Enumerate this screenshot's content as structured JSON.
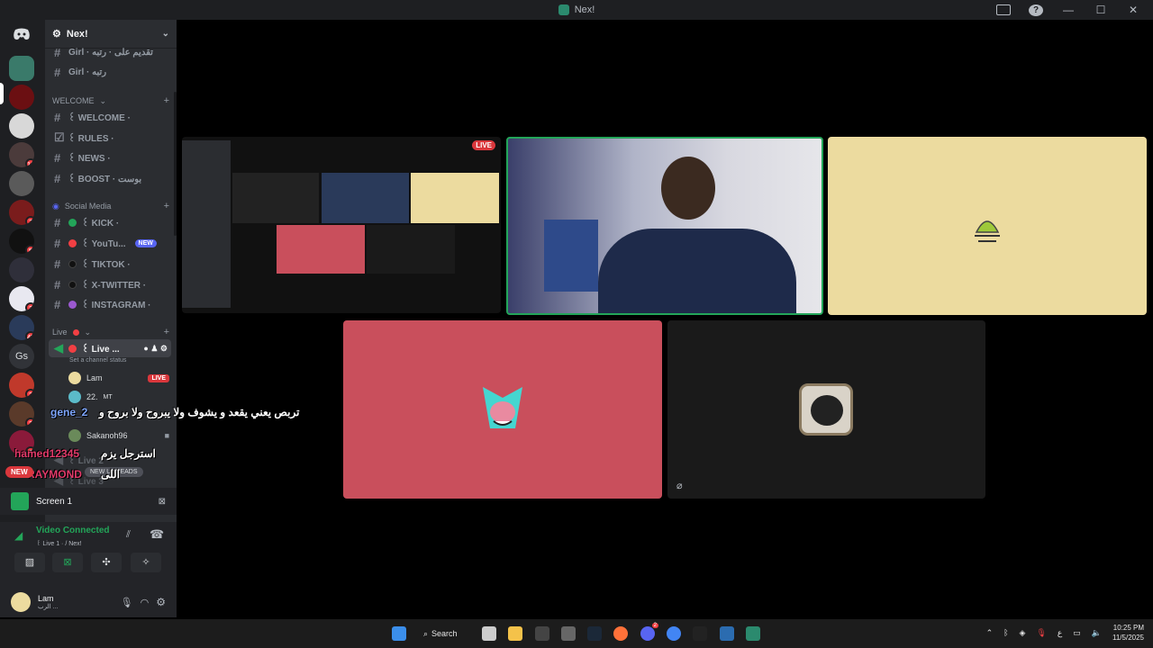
{
  "window": {
    "title": "Nex!"
  },
  "server_rail": {
    "badges": [
      "16",
      "7",
      "5",
      "2",
      "45",
      "2",
      "2",
      "2"
    ],
    "gs_label": "Gs"
  },
  "sidebar": {
    "guild_name": "Nex!",
    "top_channels": [
      {
        "label": "Girl · تقديم على · رتبه"
      },
      {
        "label": "Girl · رتبه"
      }
    ],
    "welcome_category": "WELCOME",
    "welcome_channels": [
      {
        "label": "꒰ WELCOME ·"
      },
      {
        "label": "꒰ RULES ·"
      },
      {
        "label": "꒰ NEWS ·"
      },
      {
        "label": "꒰ BOOST · بوست"
      }
    ],
    "social_category": "Social Media",
    "social_channels": [
      {
        "label": "꒰ KICK ·",
        "color": "#23a559"
      },
      {
        "label": "꒰ YouTu...",
        "color": "#f23f43",
        "badge": "NEW"
      },
      {
        "label": "꒰ TIKTOK ·",
        "color": "#111111"
      },
      {
        "label": "꒰ X-TWITTER ·",
        "color": "#111111"
      },
      {
        "label": "꒰ INSTAGRAM ·",
        "color": "#9b59d0"
      }
    ],
    "live_category": "Live",
    "voice_channel": "꒰ Live ...",
    "channel_status": "Set a channel status",
    "members": [
      {
        "name": "Lam",
        "badge": "LIVE"
      },
      {
        "name": "22.",
        "extra": "MT"
      },
      {
        "name": "Sakanoh96"
      }
    ],
    "more_channels": [
      "꒰ Live 2",
      "꒰ Live 3"
    ],
    "new_unreads": "NEW UNREADS"
  },
  "screen_share": {
    "label": "Screen 1"
  },
  "voice": {
    "status": "Video Connected",
    "channel": "꒰ Live 1 · / Nex!"
  },
  "user": {
    "name": "Lam",
    "status": "الرب ..."
  },
  "overlays": {
    "name1": "gene_2",
    "line1": "تربص يعني يقعد و يشوف ولا يبروح ولا بروح و",
    "name2": "hamed12345",
    "line2": "استرجل يزم",
    "name3": "RAYMOND",
    "line3": "اللى",
    "new_tag": "NEW"
  },
  "stream": {
    "live_tag": "LIVE"
  },
  "taskbar": {
    "search": "Search",
    "lang": "ع",
    "time": "10:25 PM",
    "date": "11/5/2025",
    "discord_badge": "2"
  },
  "colors": {
    "discord_bg": "#2b2d31",
    "rail_bg": "#1e1f22",
    "accent_green": "#23a559",
    "live_red": "#da373c",
    "tile_cream": "#ecdb9f",
    "tile_pink": "#c94f5c",
    "tile_dark": "#1a1a1a"
  }
}
